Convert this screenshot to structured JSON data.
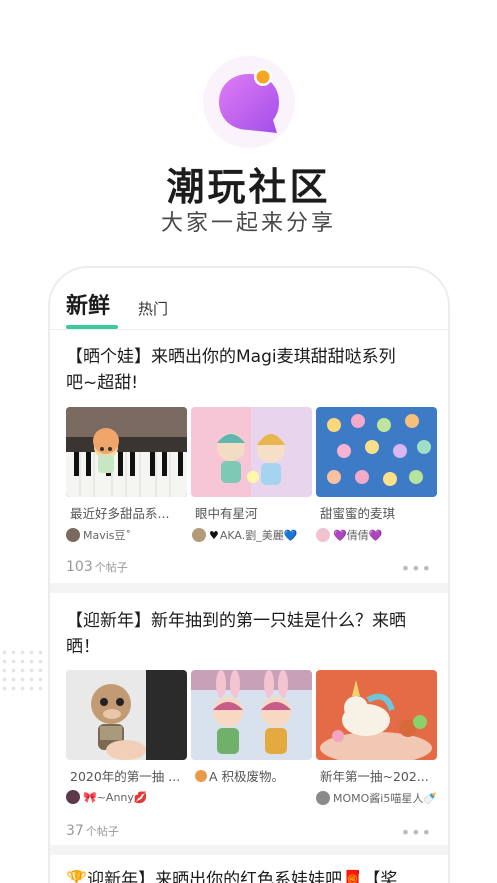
{
  "app": {
    "title": "潮玩社区",
    "subtitle": "大家一起来分享",
    "brand_colors": {
      "primary_purple": "#c86df0",
      "accent_orange": "#f5a623",
      "tab_accent": "#3bc9a0"
    }
  },
  "tabs": {
    "new": "新鲜",
    "hot": "热门"
  },
  "posts": [
    {
      "title_line1": "【晒个娃】来晒出你的Magi麦琪甜甜哒系列",
      "title_line2": "吧~超甜!",
      "items": [
        {
          "caption": "最近好多甜品系...",
          "user": "Mavis豆˚"
        },
        {
          "caption": "眼中有星河",
          "user": "AKA.劉_美麗💙"
        },
        {
          "caption": "甜蜜蜜的麦琪",
          "user": "💜倩倩💜"
        }
      ],
      "count": "103",
      "count_unit": "个帖子",
      "more": "•••"
    },
    {
      "title_line1": "【迎新年】新年抽到的第一只娃是什么？来晒",
      "title_line2": "晒！",
      "items": [
        {
          "caption": "2020年的第一抽 ...",
          "user": "🎀~Anny💋"
        },
        {
          "caption": "A 积极废物。",
          "user": ""
        },
        {
          "caption": "新年第一抽~202...",
          "user": "MOMO酱i5喵星人🍼"
        }
      ],
      "count": "37",
      "count_unit": "个帖子",
      "more": "•••"
    },
    {
      "title_partial": "🏆迎新年】来晒出你的红色系娃娃吧🧧【奖"
    }
  ]
}
